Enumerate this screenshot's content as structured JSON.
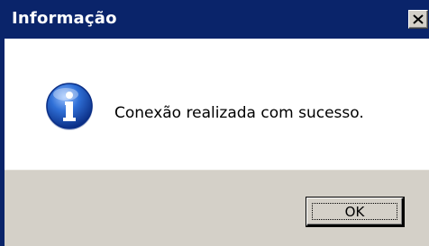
{
  "dialog": {
    "title": "Informação",
    "close_icon": "close-icon",
    "icon": "information-icon",
    "message": "Conexão realizada com sucesso.",
    "ok_label": "OK"
  },
  "colors": {
    "titlebar": "#0a246a",
    "window_face": "#d4d0c8",
    "content_bg": "#ffffff",
    "info_icon_blue": "#1f5fbf"
  }
}
